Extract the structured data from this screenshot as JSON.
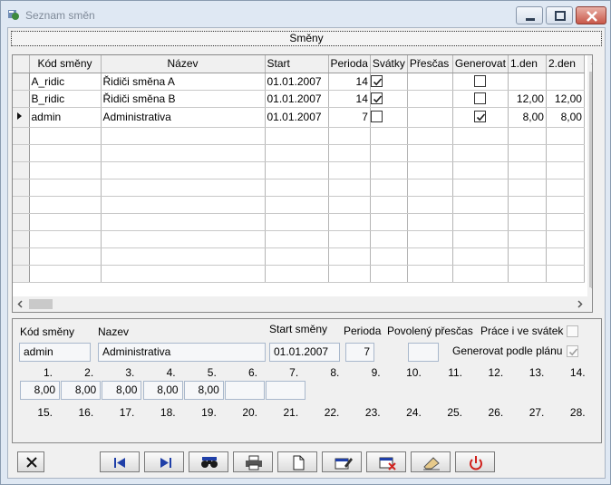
{
  "window": {
    "title": "Seznam směn"
  },
  "panel_caption": "Směny",
  "grid": {
    "columns": [
      "Kód směny",
      "Název",
      "Start",
      "Perioda",
      "Svátky",
      "Přesčas",
      "Generovat",
      "1.den",
      "2.den"
    ],
    "rows": [
      {
        "indicator": "",
        "kod": "A_ridic",
        "nazev": "Řidiči směna A",
        "start": "01.01.2007",
        "perioda": "14",
        "svatky": true,
        "prescas": "",
        "generovat": false,
        "den1": "",
        "den2": ""
      },
      {
        "indicator": "",
        "kod": "B_ridic",
        "nazev": "Řidiči směna B",
        "start": "01.01.2007",
        "perioda": "14",
        "svatky": true,
        "prescas": "",
        "generovat": false,
        "den1": "12,00",
        "den2": "12,00"
      },
      {
        "indicator": "current",
        "kod": "admin",
        "nazev": "Administrativa",
        "start": "01.01.2007",
        "perioda": "7",
        "svatky": false,
        "prescas": "",
        "generovat": true,
        "den1": "8,00",
        "den2": "8,00"
      }
    ],
    "empty_rows": 9
  },
  "form": {
    "kod_label": "Kód směny",
    "kod_value": "admin",
    "nazev_label": "Nazev",
    "nazev_value": "Administrativa",
    "start_label": "Start směny",
    "start_value": "01.01.2007",
    "perioda_label": "Perioda",
    "perioda_value": "7",
    "prescas_label": "Povolený přesčas",
    "prescas_value": "",
    "svatek_label": "Práce i ve svátek",
    "svatek_checked": false,
    "generovat_label": "Generovat podle plánu",
    "generovat_checked": true,
    "day_numbers_row1": [
      "1.",
      "2.",
      "3.",
      "4.",
      "5.",
      "6.",
      "7.",
      "8.",
      "9.",
      "10.",
      "11.",
      "12.",
      "13.",
      "14."
    ],
    "day_values_row1": [
      "8,00",
      "8,00",
      "8,00",
      "8,00",
      "8,00",
      "",
      ""
    ],
    "day_numbers_row2": [
      "15.",
      "16.",
      "17.",
      "18.",
      "19.",
      "20.",
      "21.",
      "22.",
      "23.",
      "24.",
      "25.",
      "26.",
      "27.",
      "28."
    ]
  },
  "toolbar": {
    "buttons": [
      "close-x-icon",
      "first-record-icon",
      "last-record-icon",
      "search-binoculars-icon",
      "printer-icon",
      "new-document-icon",
      "edit-record-icon",
      "delete-record-icon",
      "eraser-icon",
      "power-icon"
    ]
  },
  "colors": {
    "accent_blue": "#1f3fa8",
    "power_red": "#d0211c",
    "delete_red": "#d2231f"
  }
}
